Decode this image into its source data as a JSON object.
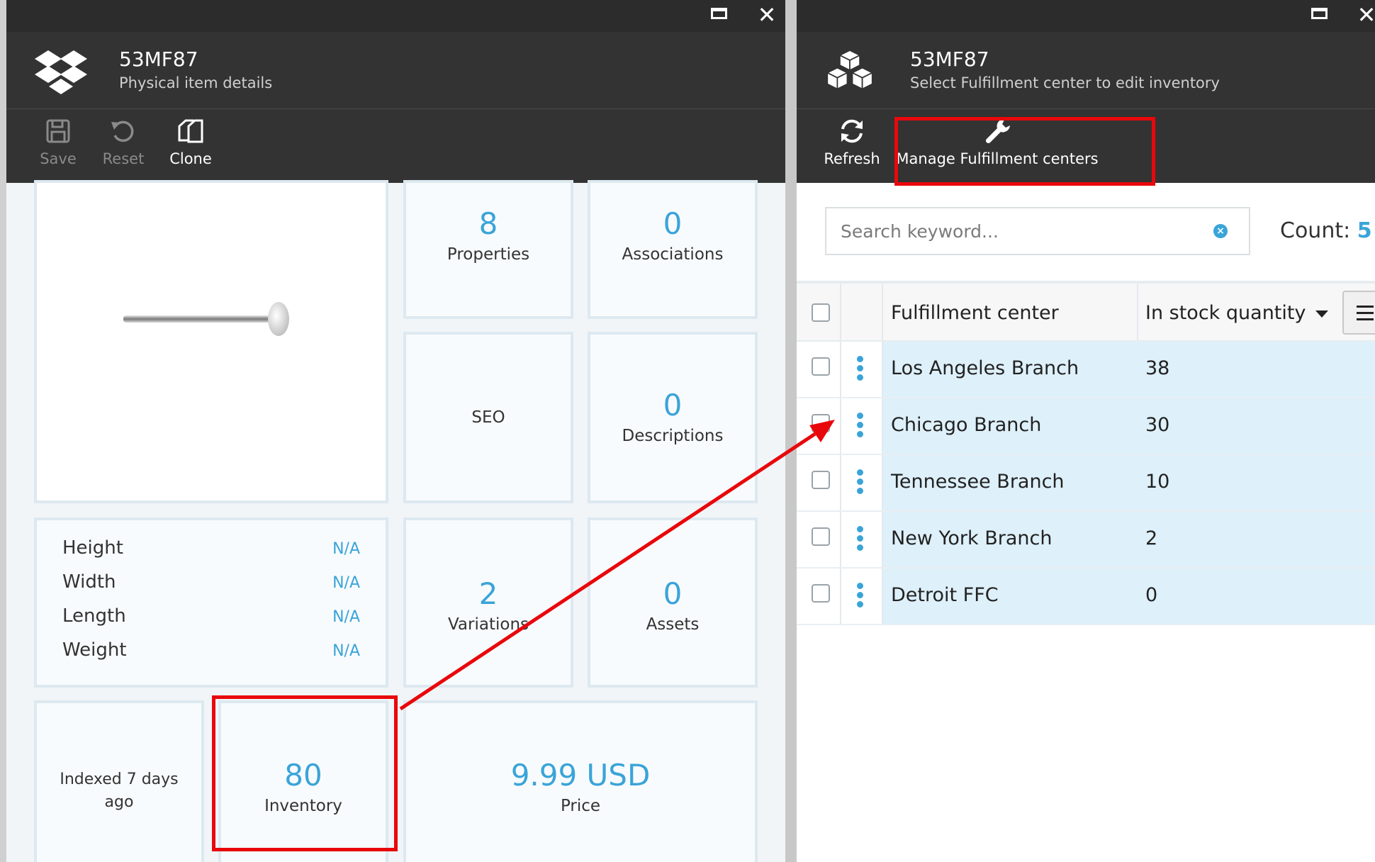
{
  "left": {
    "window_controls": {
      "maximize": "maximize-icon",
      "close": "close-icon"
    },
    "header": {
      "title": "53MF87",
      "subtitle": "Physical item details",
      "icon": "dropbox-icon"
    },
    "toolbar": {
      "save": {
        "label": "Save",
        "icon": "save-icon"
      },
      "reset": {
        "label": "Reset",
        "icon": "undo-icon"
      },
      "clone": {
        "label": "Clone",
        "icon": "clone-icon"
      }
    },
    "tiles": {
      "properties": {
        "value": "8",
        "label": "Properties"
      },
      "associations": {
        "value": "0",
        "label": "Associations"
      },
      "seo": {
        "label": "SEO"
      },
      "descriptions": {
        "value": "0",
        "label": "Descriptions"
      },
      "variations": {
        "value": "2",
        "label": "Variations"
      },
      "assets": {
        "value": "0",
        "label": "Assets"
      },
      "indexed": {
        "label": "Indexed 7 days ago"
      },
      "inventory": {
        "value": "80",
        "label": "Inventory"
      },
      "price": {
        "value": "9.99 USD",
        "label": "Price"
      }
    },
    "dimensions": [
      {
        "label": "Height",
        "value": "N/A"
      },
      {
        "label": "Width",
        "value": "N/A"
      },
      {
        "label": "Length",
        "value": "N/A"
      },
      {
        "label": "Weight",
        "value": "N/A"
      }
    ]
  },
  "right": {
    "window_controls": {
      "maximize": "maximize-icon",
      "close": "close-icon"
    },
    "header": {
      "title": "53MF87",
      "subtitle": "Select Fulfillment center to edit inventory",
      "icon": "cubes-icon"
    },
    "toolbar": {
      "refresh": {
        "label": "Refresh",
        "icon": "refresh-icon"
      },
      "manage": {
        "label": "Manage Fulfillment centers",
        "icon": "wrench-icon"
      }
    },
    "search": {
      "placeholder": "Search keyword..."
    },
    "count": {
      "label": "Count:",
      "value": "5"
    },
    "grid": {
      "columns": [
        "Fulfillment center",
        "In stock quantity"
      ],
      "rows": [
        {
          "name": "Los Angeles Branch",
          "qty": "38"
        },
        {
          "name": "Chicago Branch",
          "qty": "30"
        },
        {
          "name": "Tennessee Branch",
          "qty": "10"
        },
        {
          "name": "New York Branch",
          "qty": "2"
        },
        {
          "name": "Detroit FFC",
          "qty": "0"
        }
      ]
    }
  },
  "colors": {
    "accent": "#3aa4d8",
    "highlight": "#e8080b",
    "header_bg": "#333333",
    "row_tint": "#def0fa"
  }
}
